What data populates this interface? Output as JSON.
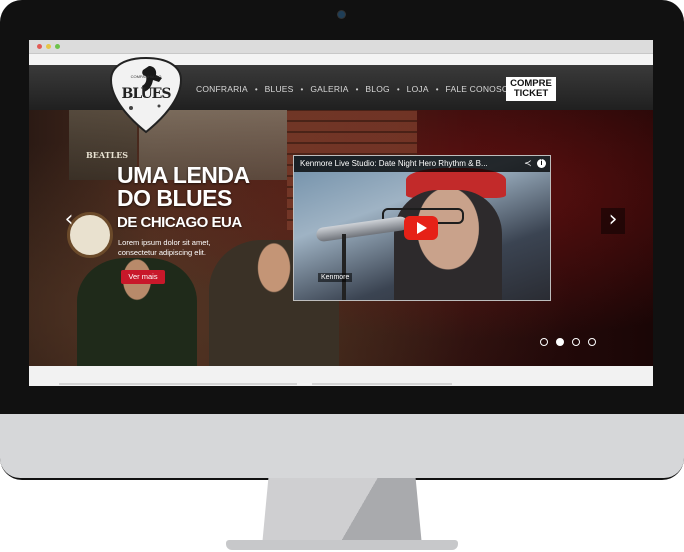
{
  "site": {
    "logo": {
      "top_text": "COMPANHIA DO",
      "main_text": "BLUES"
    },
    "nav": [
      "CONFRARIA",
      "BLUES",
      "GALERIA",
      "BLOG",
      "LOJA",
      "FALE CONOSCO"
    ],
    "ticket": {
      "line1": "COMPRE",
      "line2": "TICKET"
    }
  },
  "hero": {
    "title_line1": "UMA LENDA",
    "title_line2": "DO BLUES",
    "subtitle": "DE CHICAGO EUA",
    "body": "Lorem ipsum dolor sit amet, consectetur adipiscing elit.",
    "cta_label": "Ver mais",
    "poster_label": "BEATLES",
    "arrow_left": "‹",
    "arrow_right": "›",
    "slides": {
      "count": 4,
      "active_index": 1
    }
  },
  "video": {
    "title": "Kenmore Live Studio: Date Night Hero Rhythm & B...",
    "watermark": "Kenmore",
    "share_symbol": "≺",
    "info_symbol": "i"
  },
  "icons": {
    "browser_close": "red-dot-icon",
    "browser_minimize": "yellow-dot-icon",
    "browser_maximize": "green-dot-icon",
    "play": "play-icon",
    "share": "share-icon",
    "info": "info-icon"
  },
  "colors": {
    "accent": "#c8182a",
    "youtube_red": "#e62117",
    "header_bg": "#2a2a2a"
  }
}
